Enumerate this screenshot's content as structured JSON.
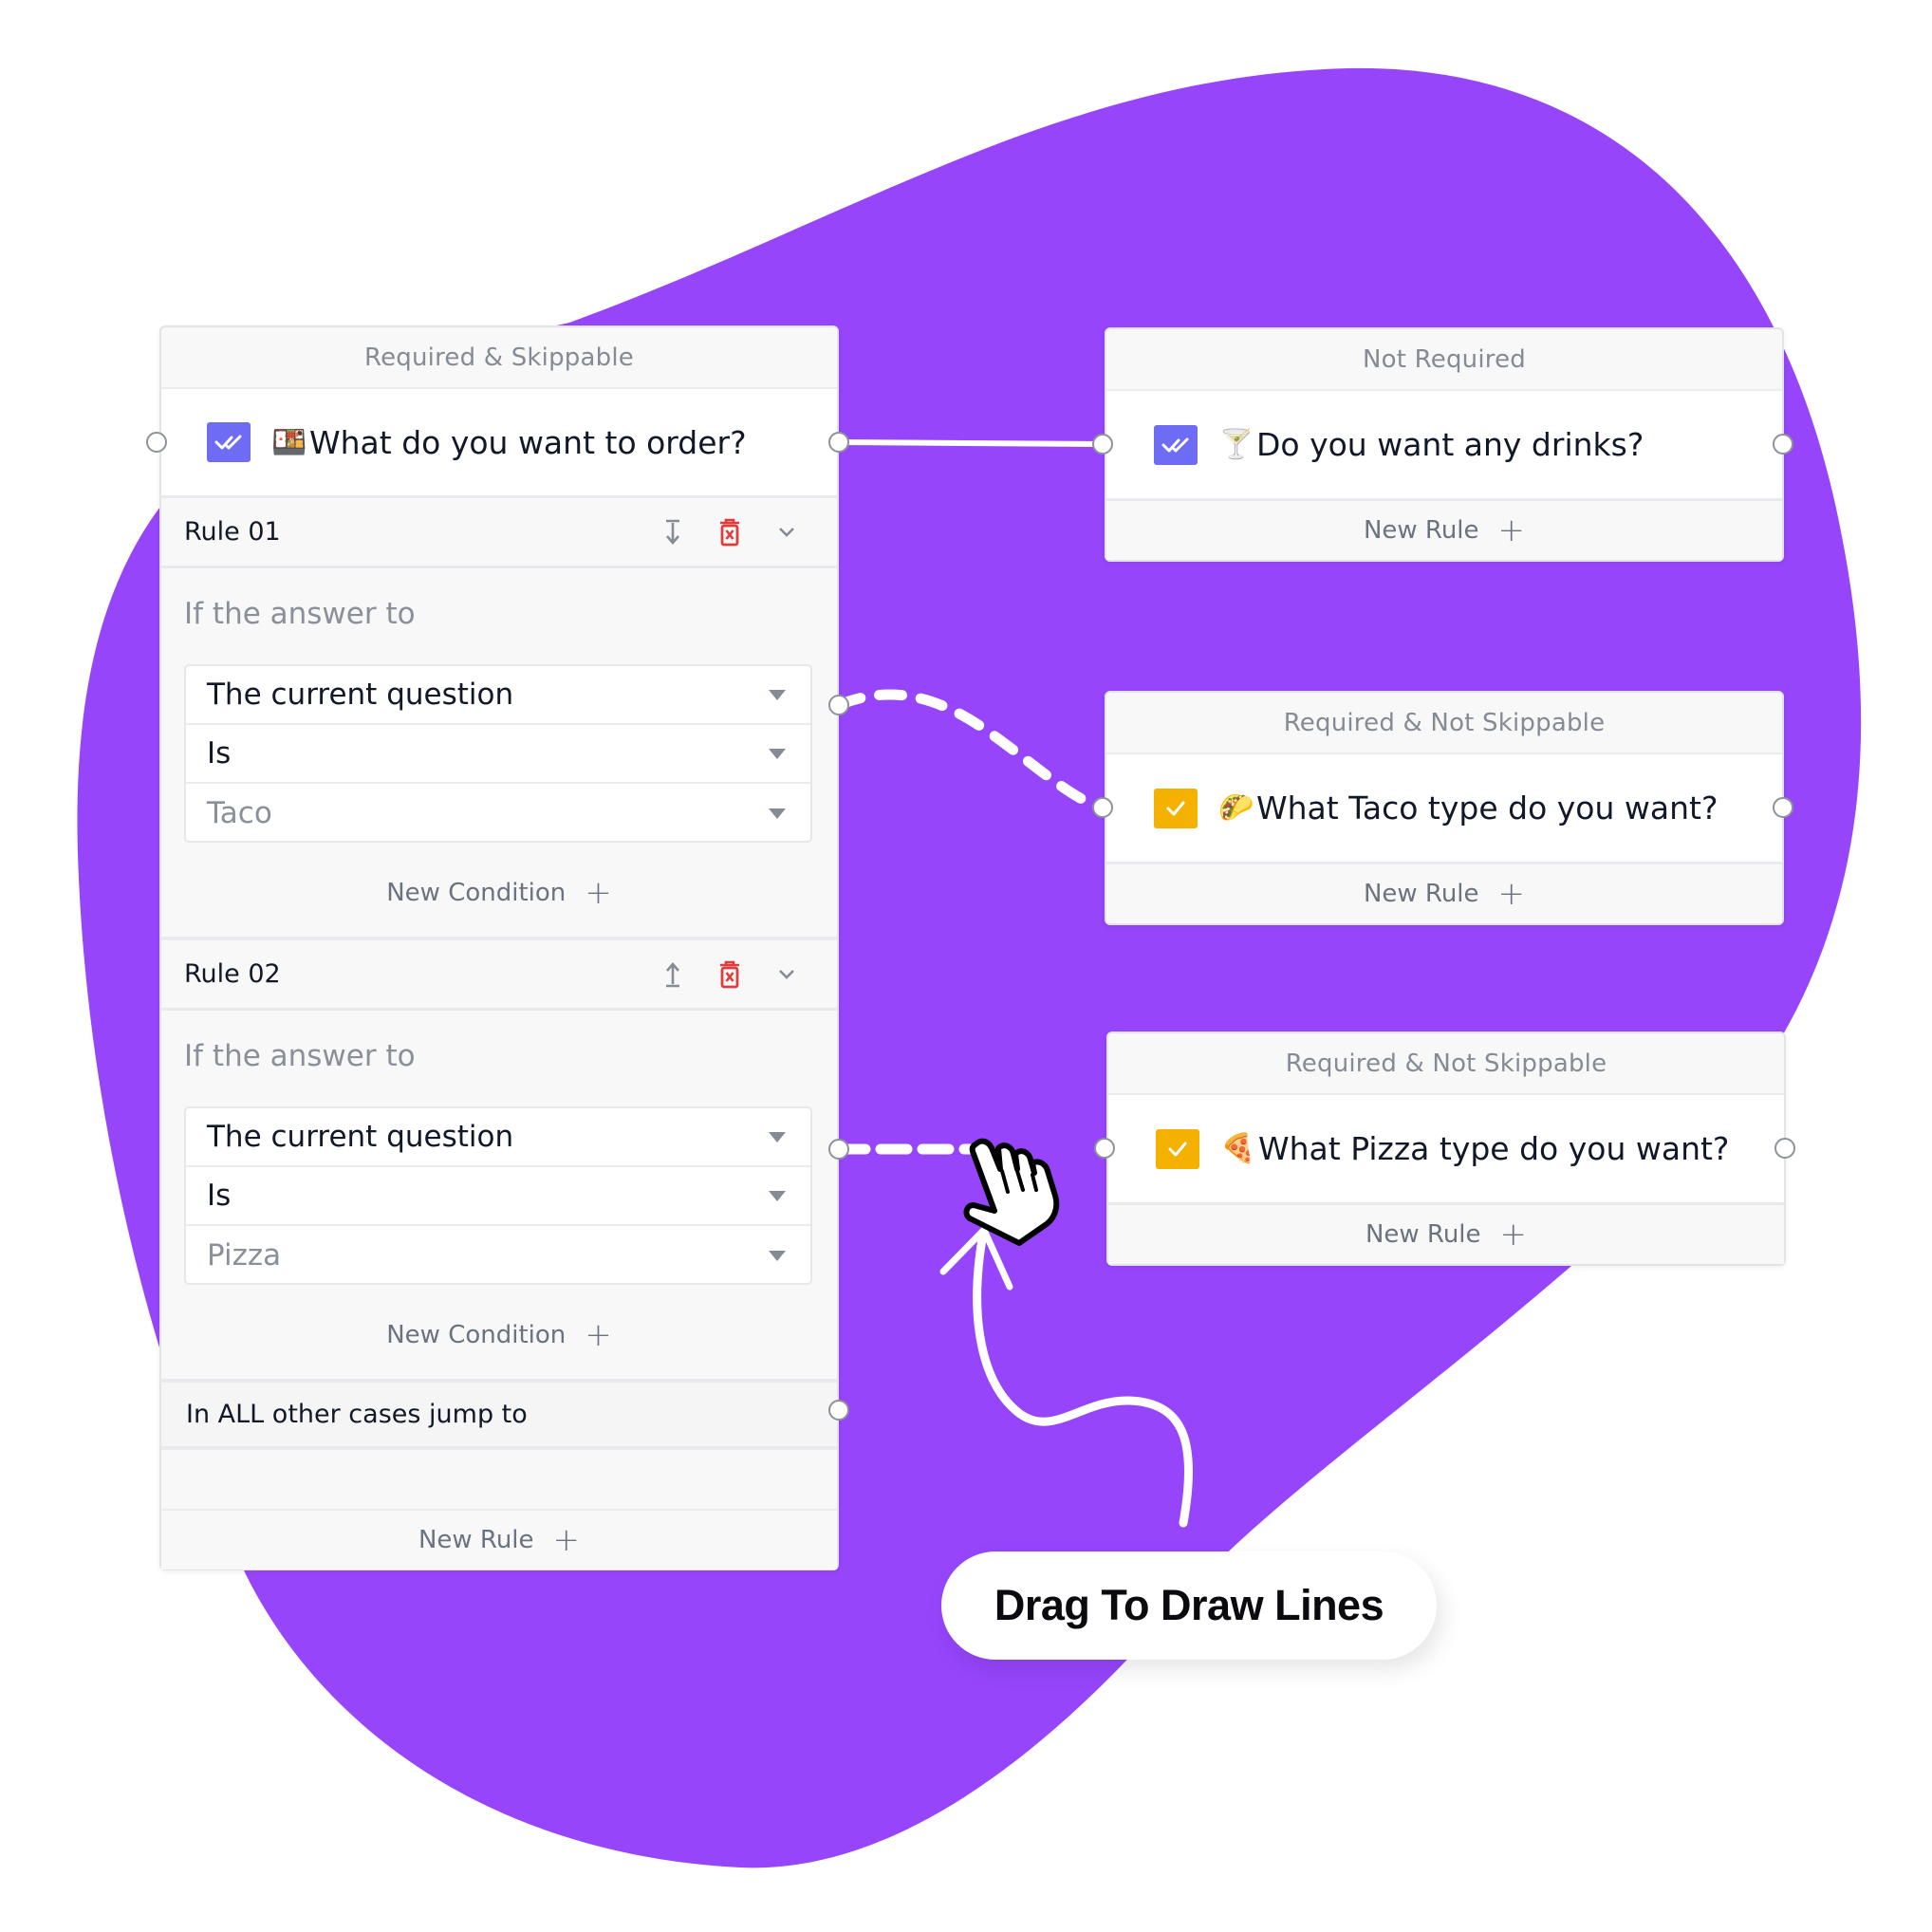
{
  "colors": {
    "blob": "#9645fb",
    "checkbox_blue": "#6e6cf5",
    "checkbox_yellow": "#f5b100",
    "delete_red": "#e03c3c",
    "connector_line": "#ffffff"
  },
  "main_card": {
    "header": "Required & Skippable",
    "question": {
      "checkbox_icon": "double-check-icon",
      "emoji": "🍱",
      "text": "What do you want to order?"
    },
    "rules": [
      {
        "title": "Rule 01",
        "move_icon": "move-down-icon",
        "delete_icon": "trash-icon",
        "collapse_icon": "chevron-down-icon",
        "if_label": "If the answer to",
        "conditions": {
          "question": "The current question",
          "operator": "Is",
          "value": "Taco"
        },
        "new_condition_label": "New Condition",
        "target": "What Taco type do you want?"
      },
      {
        "title": "Rule 02",
        "move_icon": "move-up-icon",
        "delete_icon": "trash-icon",
        "collapse_icon": "chevron-down-icon",
        "if_label": "If the answer to",
        "conditions": {
          "question": "The current question",
          "operator": "Is",
          "value": "Pizza"
        },
        "new_condition_label": "New Condition",
        "target": "(dragging)"
      }
    ],
    "all_other_cases_label": "In ALL other cases jump to",
    "new_rule_label": "New Rule"
  },
  "target_cards": [
    {
      "header": "Not Required",
      "checkbox_icon": "double-check-icon",
      "checkbox_color": "blue",
      "emoji": "🍸",
      "text": "Do you want any drinks?",
      "new_rule_label": "New Rule"
    },
    {
      "header": "Required & Not Skippable",
      "checkbox_icon": "check-icon",
      "checkbox_color": "yellow",
      "emoji": "🌮",
      "text": "What Taco type do you want?",
      "new_rule_label": "New Rule"
    },
    {
      "header": "Required & Not Skippable",
      "checkbox_icon": "check-icon",
      "checkbox_color": "yellow",
      "emoji": "🍕",
      "text": "What Pizza type do you want?",
      "new_rule_label": "New Rule"
    }
  ],
  "callout": {
    "text": "Drag To Draw Lines",
    "cursor_icon": "hand-pointer-icon",
    "arrow_icon": "curved-arrow-icon"
  },
  "plus_glyph": "+"
}
